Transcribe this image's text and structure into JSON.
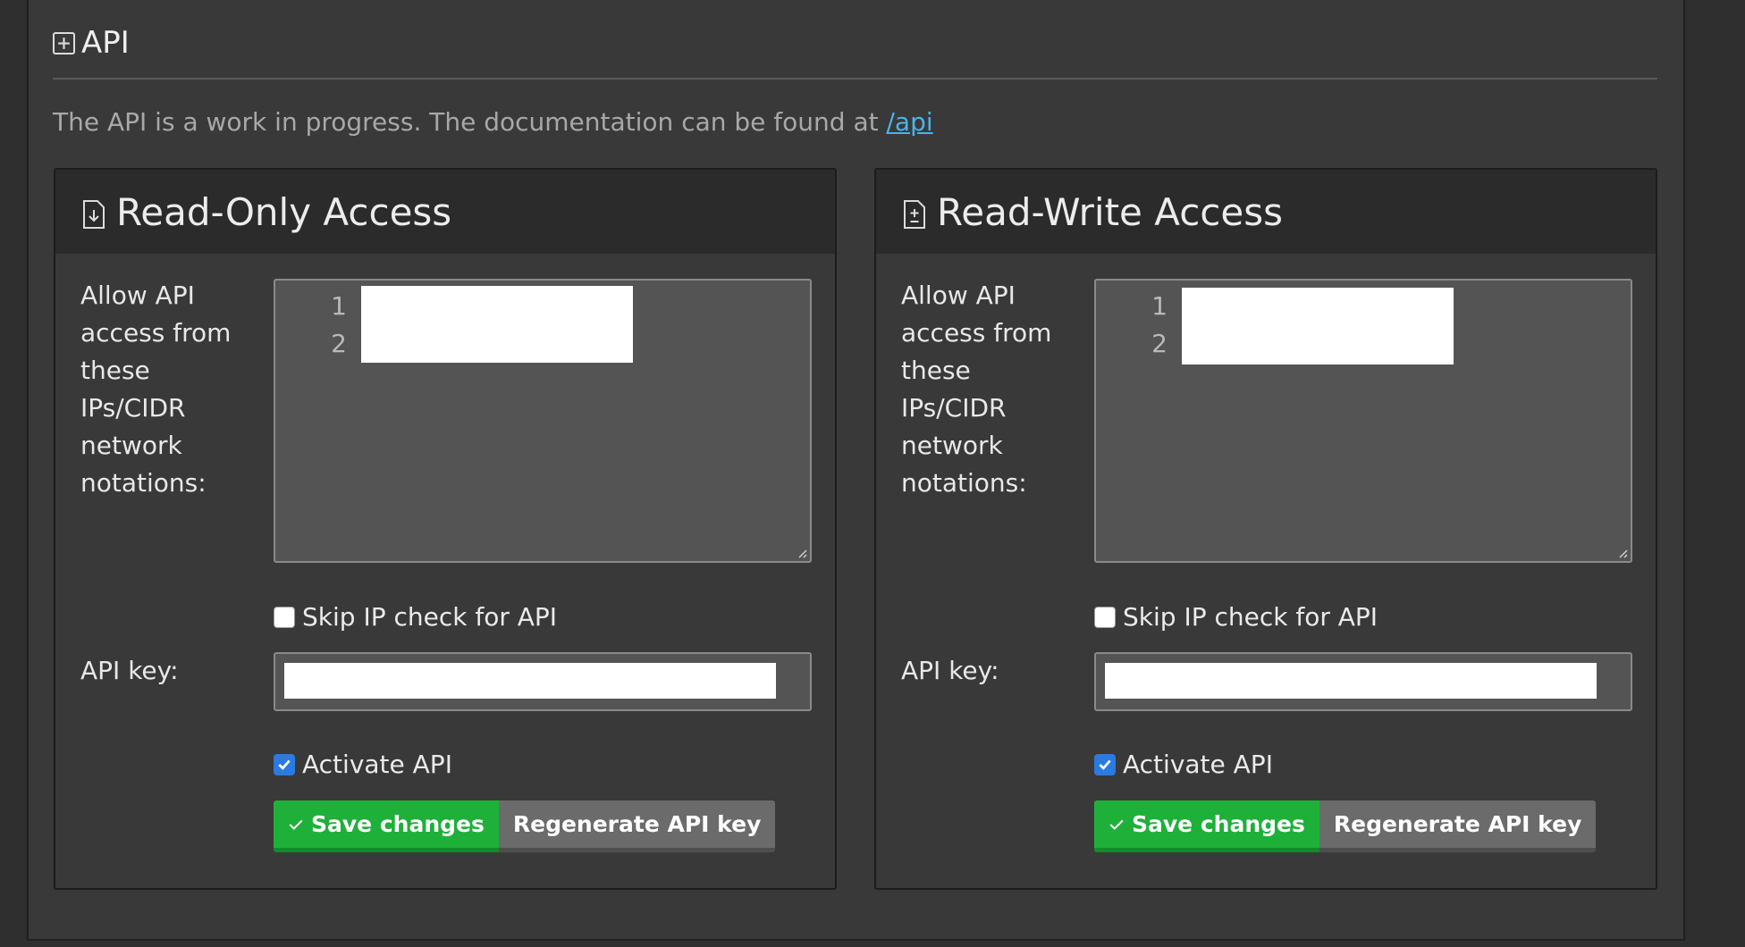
{
  "section": {
    "title": "API",
    "info_text": "The API is a work in progress. The documentation can be found at ",
    "info_link": "/api"
  },
  "panels": [
    {
      "title": "Read-Only Access",
      "ips_label": "Allow API access from these IPs/CIDR network notations:",
      "line_numbers": [
        "1",
        "2"
      ],
      "skip_ip_label": "Skip IP check for API",
      "skip_ip_checked": false,
      "api_key_label": "API key:",
      "activate_label": "Activate API",
      "activate_checked": true,
      "save_label": "Save changes",
      "regenerate_label": "Regenerate API key"
    },
    {
      "title": "Read-Write Access",
      "ips_label": "Allow API access from these IPs/CIDR network notations:",
      "line_numbers": [
        "1",
        "2"
      ],
      "skip_ip_label": "Skip IP check for API",
      "skip_ip_checked": false,
      "api_key_label": "API key:",
      "activate_label": "Activate API",
      "activate_checked": true,
      "save_label": "Save changes",
      "regenerate_label": "Regenerate API key"
    }
  ],
  "colors": {
    "link": "#4ab3e8",
    "save_button": "#1fb03a",
    "regenerate_button": "#6b6b6b",
    "checkbox_checked": "#2a7ae2"
  },
  "icons": {
    "section": "plus-square-icon",
    "read_only": "file-download-icon",
    "read_write": "file-plus-minus-icon"
  }
}
